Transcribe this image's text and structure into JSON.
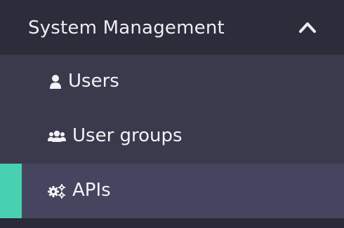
{
  "section": {
    "title": "System Management",
    "expanded": true,
    "toggle_icon": "chevron-up-icon"
  },
  "items": [
    {
      "label": "Users",
      "icon": "user-icon",
      "active": false
    },
    {
      "label": "User groups",
      "icon": "users-icon",
      "active": false
    },
    {
      "label": "APIs",
      "icon": "cogs-icon",
      "active": true
    }
  ],
  "colors": {
    "header_bg": "#2d2c3b",
    "submenu_bg": "#3b3a4d",
    "active_bg": "#454560",
    "accent": "#48d1b0",
    "text": "#f2f2f6"
  }
}
